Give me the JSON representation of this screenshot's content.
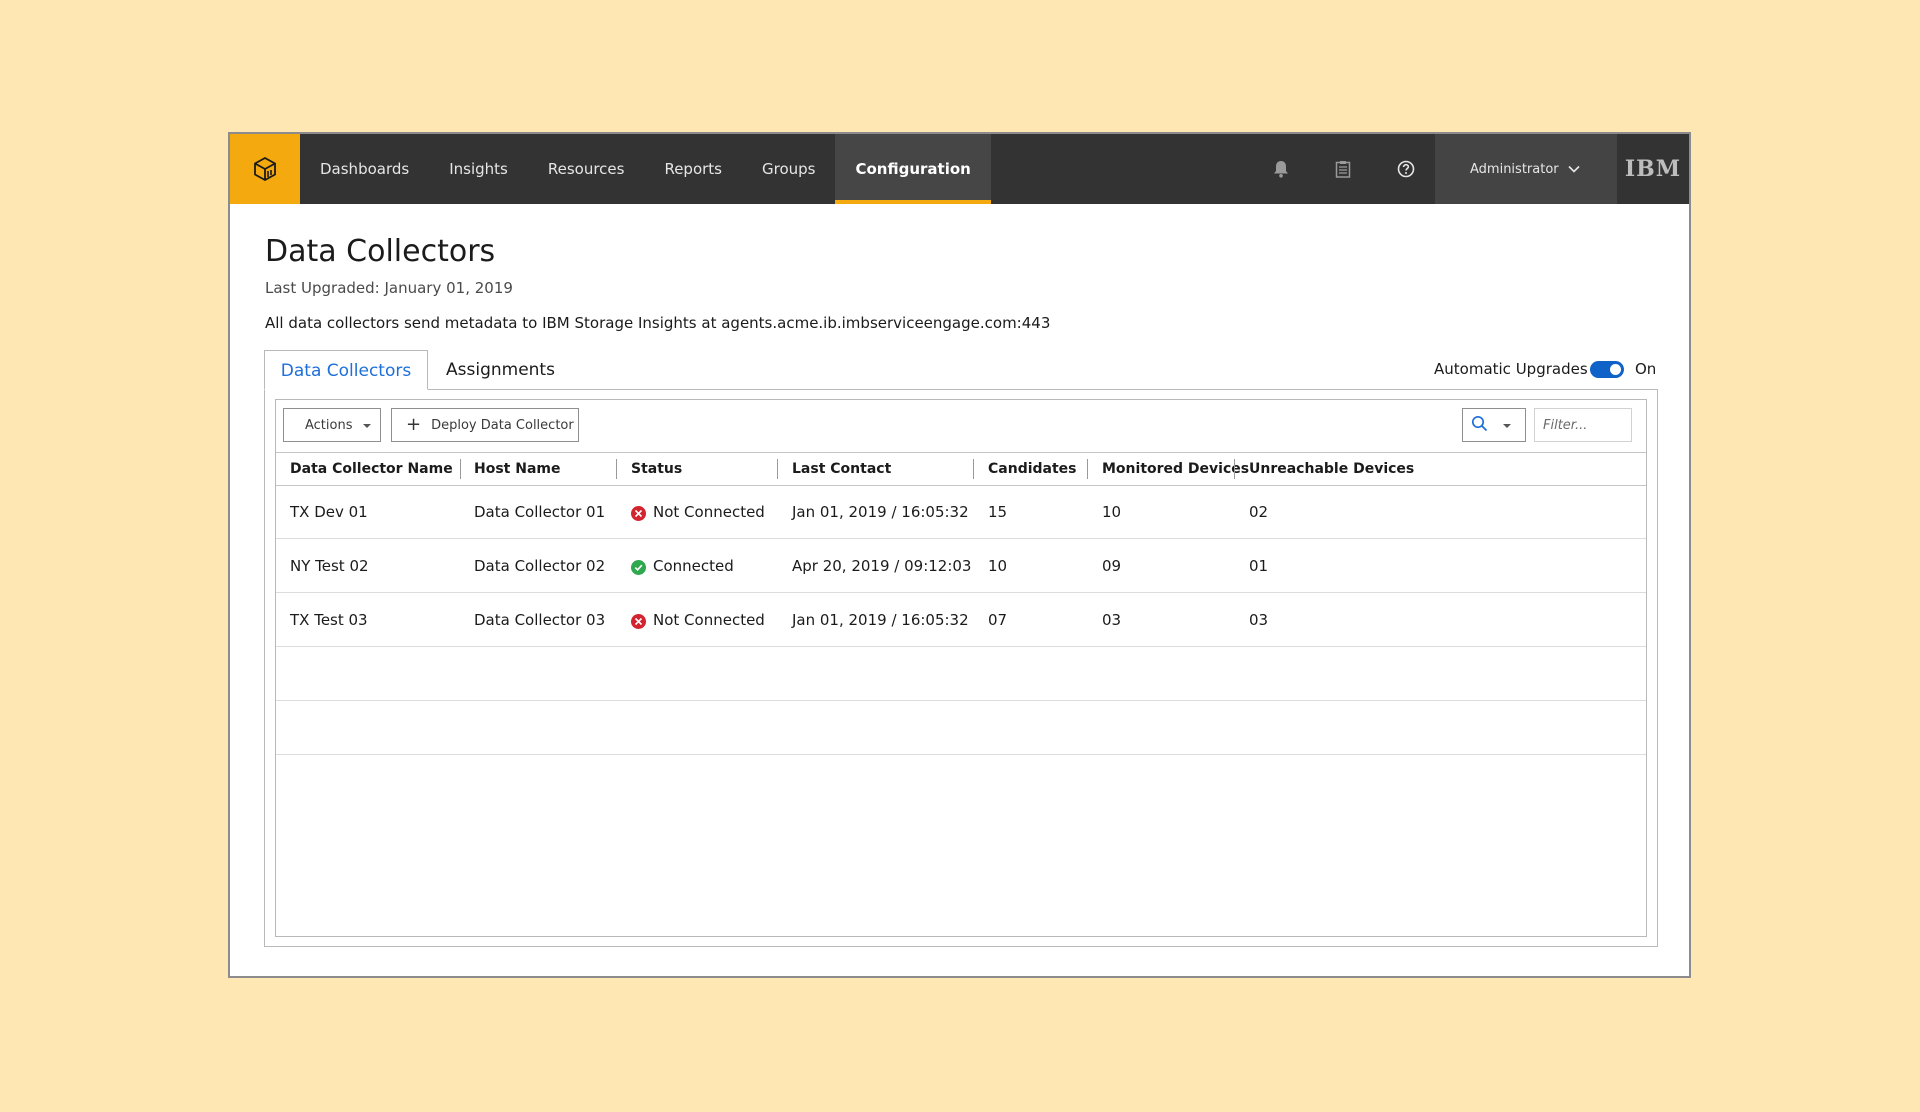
{
  "app": {
    "nav": [
      "Dashboards",
      "Insights",
      "Resources",
      "Reports",
      "Groups",
      "Configuration"
    ],
    "active_nav": "Configuration",
    "user": "Administrator",
    "brand": "IBM",
    "accent_color": "#f4a90f",
    "icons": [
      "storage-cube-icon",
      "bell-icon",
      "clipboard-icon",
      "help-icon",
      "chevron-down-icon"
    ]
  },
  "page": {
    "title": "Data Collectors",
    "last_upgraded": "Last Upgraded: January 01, 2019",
    "description": "All data collectors send metadata to IBM Storage Insights at agents.acme.ib.imbserviceengage.com:443"
  },
  "tabs": [
    "Data Collectors",
    "Assignments"
  ],
  "auto_upgrades": {
    "label": "Automatic Upgrades",
    "state": "On",
    "enabled": true
  },
  "toolbar": {
    "actions_label": "Actions",
    "deploy_label": "Deploy Data Collector",
    "filter_placeholder": "Filter..."
  },
  "table": {
    "columns": [
      "Data Collector Name",
      "Host Name",
      "Status",
      "Last Contact",
      "Candidates",
      "Monitored Devices",
      "Unreachable Devices"
    ],
    "rows": [
      {
        "name": "TX Dev 01",
        "host": "Data Collector 01",
        "status": "Not Connected",
        "status_kind": "error",
        "last_contact": "Jan 01, 2019 / 16:05:32",
        "candidates": "15",
        "monitored": "10",
        "unreachable": "02"
      },
      {
        "name": "NY Test 02",
        "host": "Data Collector 02",
        "status": "Connected",
        "status_kind": "ok",
        "last_contact": "Apr 20, 2019 / 09:12:03",
        "candidates": "10",
        "monitored": "09",
        "unreachable": "01"
      },
      {
        "name": "TX Test 03",
        "host": "Data Collector 03",
        "status": "Not Connected",
        "status_kind": "error",
        "last_contact": "Jan 01, 2019 / 16:05:32",
        "candidates": "07",
        "monitored": "03",
        "unreachable": "03"
      }
    ],
    "status_colors": {
      "error": "#d2232e",
      "ok": "#2fa84f"
    }
  }
}
